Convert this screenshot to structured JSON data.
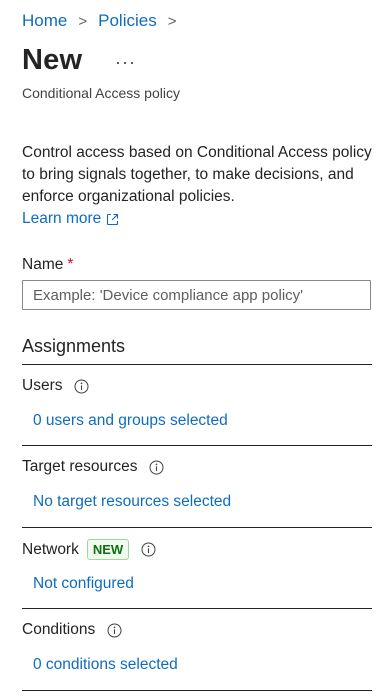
{
  "breadcrumb": {
    "items": [
      "Home",
      "Policies"
    ]
  },
  "page": {
    "title": "New",
    "more_label": "···",
    "subtitle": "Conditional Access policy"
  },
  "intro": {
    "text": "Control access based on Conditional Access policy to bring signals together, to make decisions, and enforce organizational policies.",
    "learn_more": "Learn more"
  },
  "name_field": {
    "label": "Name",
    "required_mark": "*",
    "placeholder": "Example: 'Device compliance app policy'",
    "value": ""
  },
  "assignments": {
    "heading": "Assignments",
    "users": {
      "label": "Users",
      "value": "0 users and groups selected"
    },
    "target_resources": {
      "label": "Target resources",
      "value": "No target resources selected"
    },
    "network": {
      "label": "Network",
      "badge": "NEW",
      "value": "Not configured"
    },
    "conditions": {
      "label": "Conditions",
      "value": "0 conditions selected"
    }
  },
  "colors": {
    "link": "#0f6cbd",
    "required": "#c50f1f",
    "badge_text": "#0e700e",
    "badge_bg": "#f1faf1"
  }
}
